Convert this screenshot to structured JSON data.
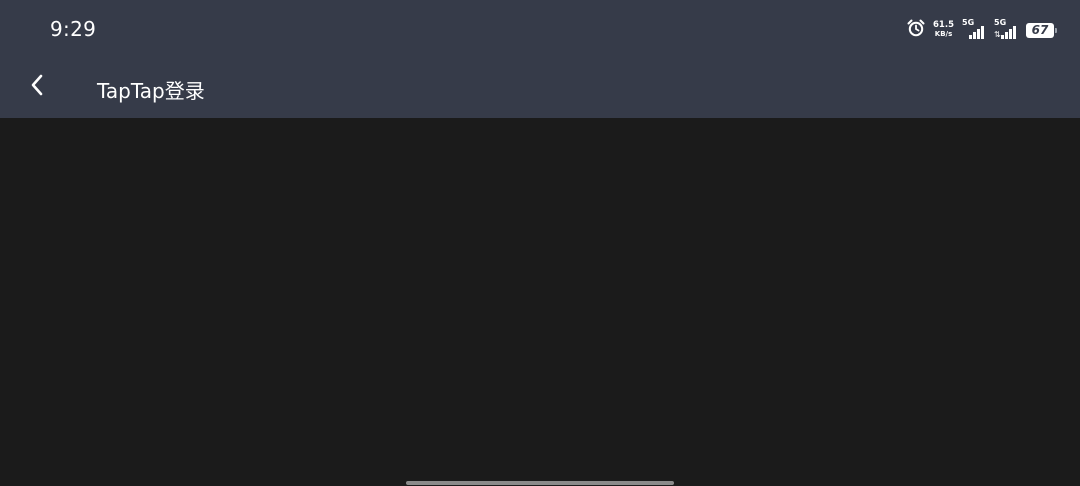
{
  "status_bar": {
    "time": "9:29",
    "net_speed_value": "61.5",
    "net_speed_unit": "KB/s",
    "signal_1_label": "5G",
    "signal_2_label": "5G",
    "battery_level": "67",
    "icons": [
      "alarm-icon",
      "signal-icon",
      "signal-icon",
      "battery-icon"
    ]
  },
  "nav_bar": {
    "back_icon": "chevron-left-icon",
    "title": "TapTap登录"
  },
  "colors": {
    "header_bg": "#363b49",
    "content_bg": "#1b1b1b",
    "text": "#ffffff"
  }
}
